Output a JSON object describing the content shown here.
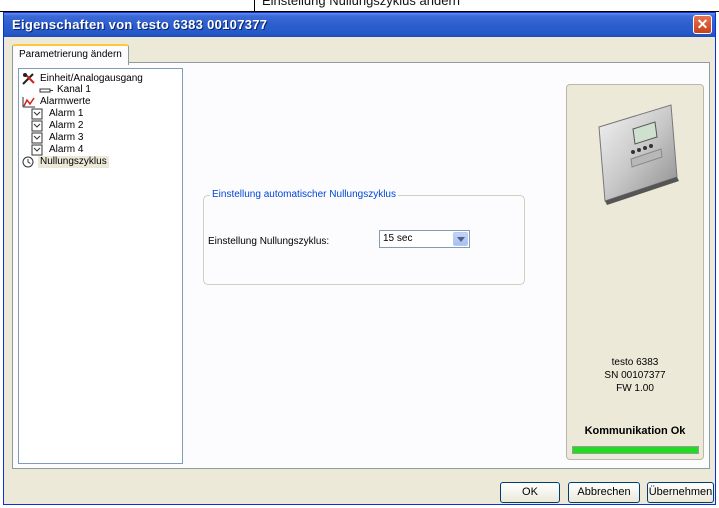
{
  "background_doc": {
    "partial_text": "Einstellung Nullungszyklus ändern"
  },
  "window": {
    "title": "Eigenschaften von testo 6383  00107377",
    "close_label": "✕"
  },
  "tab": {
    "label": "Parametrierung ändern"
  },
  "tree": {
    "items": [
      {
        "label": "Einheit/Analogausgang",
        "icon": "tools-icon"
      },
      {
        "label": "Kanal 1",
        "icon": "channel-icon"
      },
      {
        "label": "Alarmwerte",
        "icon": "alarm-chart-icon"
      },
      {
        "label": "Alarm 1",
        "icon": "alarm-item-icon"
      },
      {
        "label": "Alarm 2",
        "icon": "alarm-item-icon"
      },
      {
        "label": "Alarm 3",
        "icon": "alarm-item-icon"
      },
      {
        "label": "Alarm 4",
        "icon": "alarm-item-icon"
      },
      {
        "label": "Nullungszyklus",
        "icon": "clock-icon",
        "selected": true
      }
    ]
  },
  "group": {
    "legend": "Einstellung automatischer Nullungszyklus",
    "field_label": "Einstellung Nullungszyklus:",
    "select_value": "15 sec"
  },
  "device": {
    "model": "testo 6383",
    "serial": "SN 00107377",
    "firmware": "FW  1.00",
    "status": "Kommunikation Ok",
    "progress_fraction": 1.0,
    "progress_color": "#1edc1e"
  },
  "buttons": {
    "ok": "OK",
    "cancel": "Abbrechen",
    "apply": "Übernehmen"
  }
}
